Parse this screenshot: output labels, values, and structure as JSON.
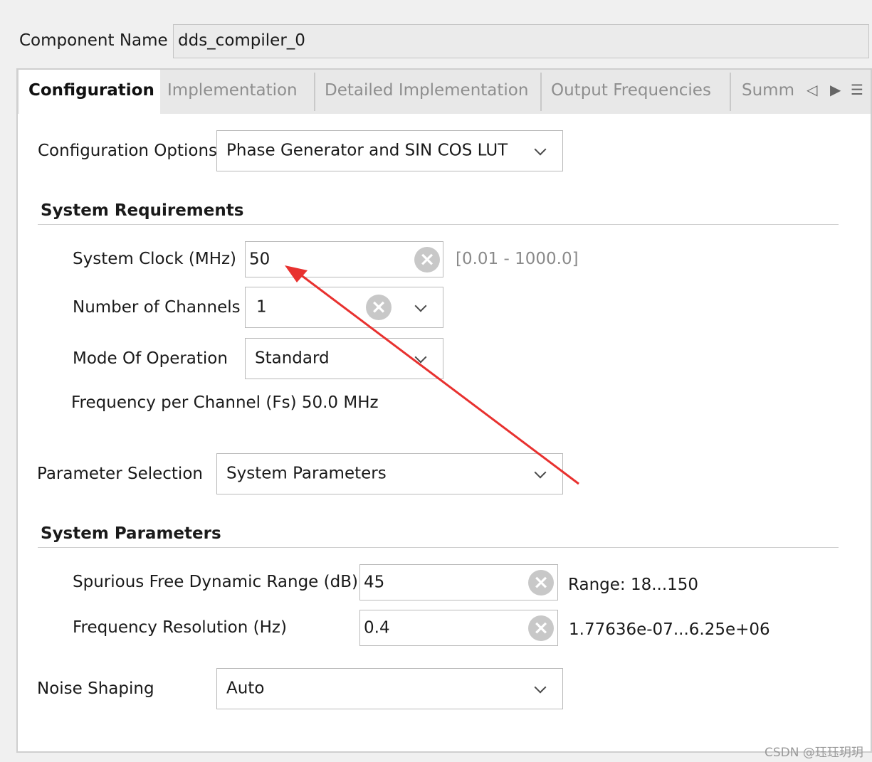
{
  "component": {
    "label": "Component Name",
    "value": "dds_compiler_0"
  },
  "tabs": [
    {
      "label": "Configuration",
      "active": true
    },
    {
      "label": "Implementation",
      "active": false
    },
    {
      "label": "Detailed Implementation",
      "active": false
    },
    {
      "label": "Output Frequencies",
      "active": false
    },
    {
      "label": "Summ",
      "active": false
    }
  ],
  "tab_controls": {
    "prev_icon": "◁",
    "next_icon": "▶",
    "menu_icon": "☰"
  },
  "configuration_options": {
    "label": "Configuration Options",
    "value": "Phase Generator and SIN COS LUT"
  },
  "system_requirements": {
    "title": "System Requirements",
    "system_clock": {
      "label": "System Clock (MHz)",
      "value": "50",
      "range": "[0.01 - 1000.0]"
    },
    "channels": {
      "label": "Number of Channels",
      "value": "1"
    },
    "mode": {
      "label": "Mode Of Operation",
      "value": "Standard"
    },
    "frequency_per_channel": "Frequency per Channel (Fs) 50.0 MHz"
  },
  "parameter_selection": {
    "label": "Parameter Selection",
    "value": "System Parameters"
  },
  "system_parameters": {
    "title": "System Parameters",
    "sfdr": {
      "label": "Spurious Free Dynamic Range (dB)",
      "value": "45",
      "range": "Range: 18...150"
    },
    "freq_resolution": {
      "label": "Frequency Resolution (Hz)",
      "value": "0.4",
      "range": "1.77636e-07...6.25e+06"
    }
  },
  "noise_shaping": {
    "label": "Noise Shaping",
    "value": "Auto"
  },
  "clear_glyph": "×",
  "watermark": "CSDN @珏珏玥玥",
  "colors": {
    "annotation_arrow": "#e8312f",
    "panel_bg": "#ffffff",
    "window_bg": "#f0f0f0"
  }
}
